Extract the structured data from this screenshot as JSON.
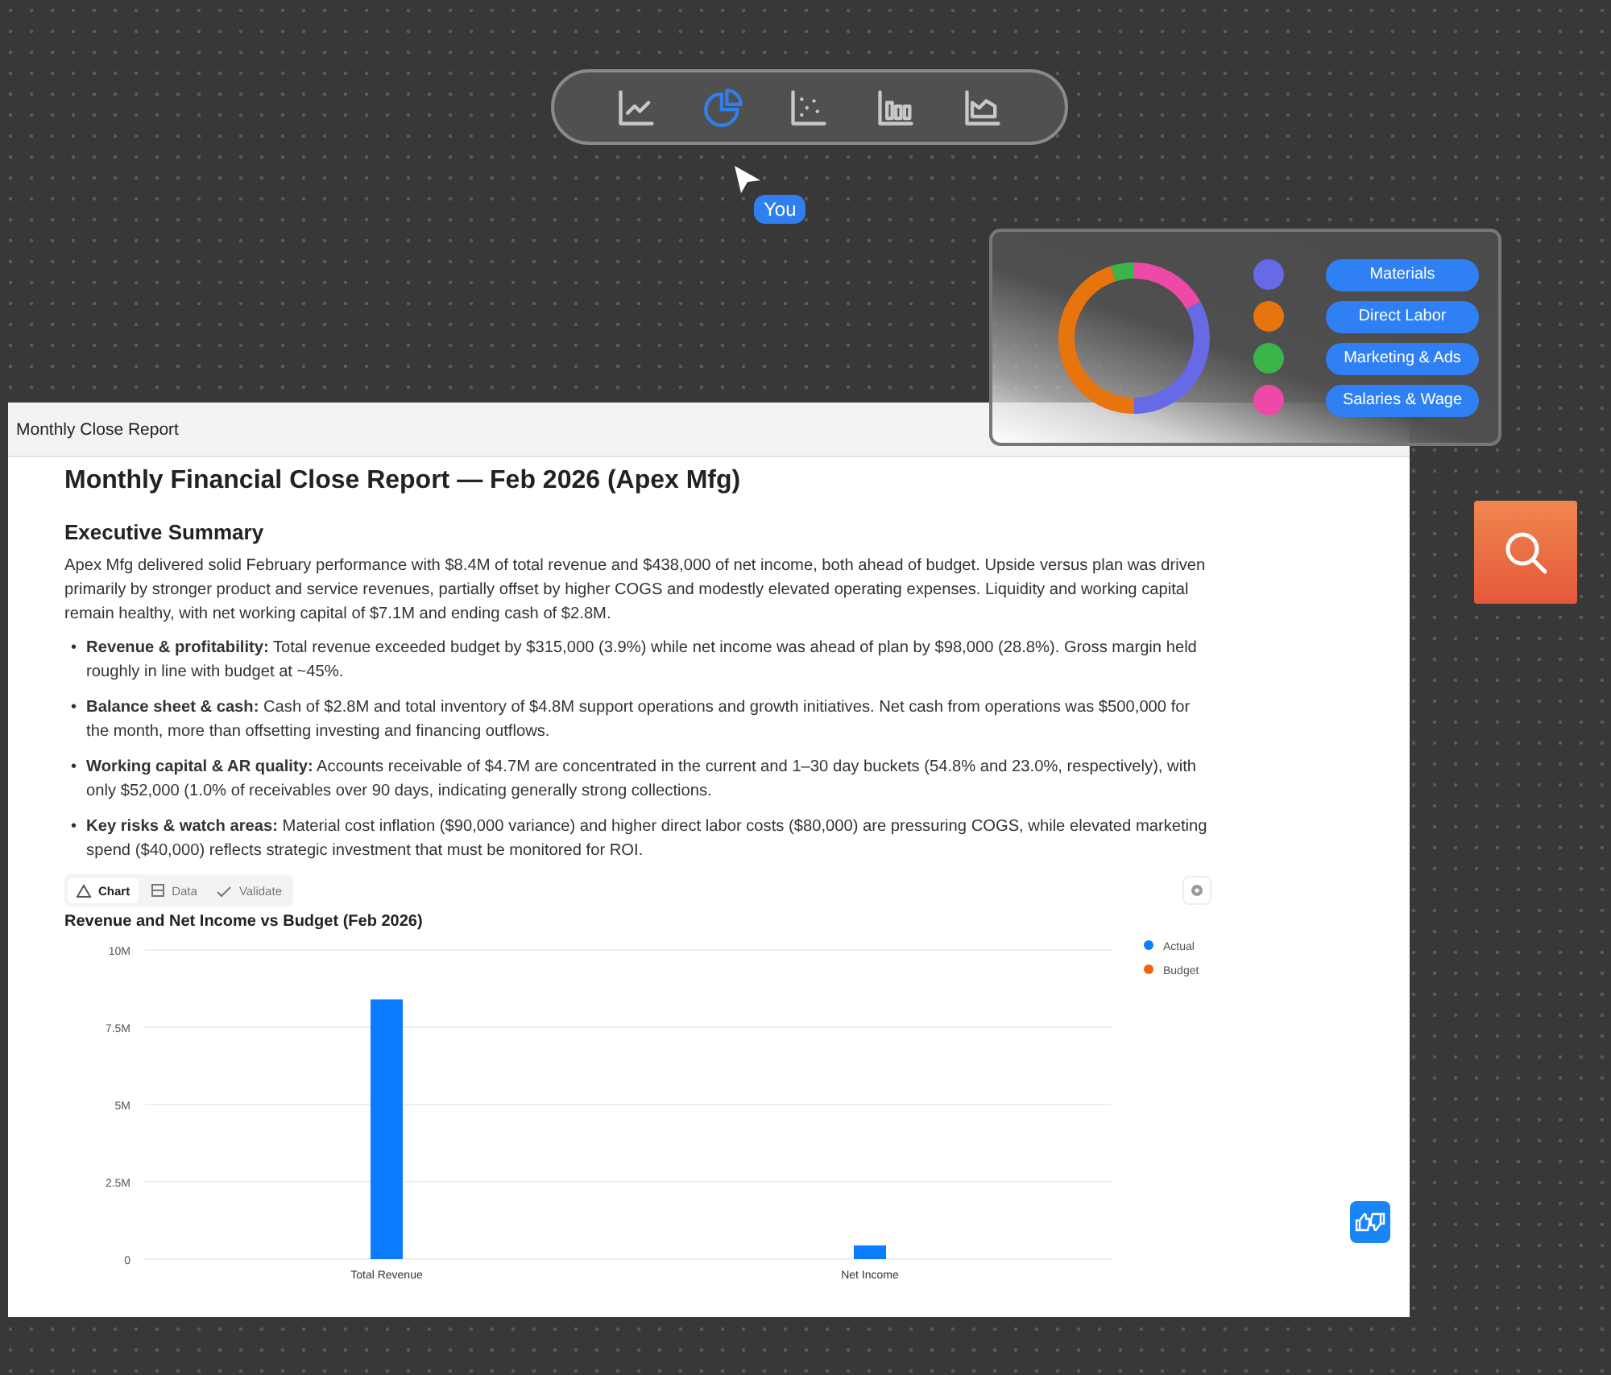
{
  "toolbar": {
    "items": [
      {
        "kind": "line",
        "selected": false
      },
      {
        "kind": "pie",
        "selected": true
      },
      {
        "kind": "scatter",
        "selected": false
      },
      {
        "kind": "bar",
        "selected": false
      },
      {
        "kind": "area",
        "selected": false
      }
    ]
  },
  "cursor": {
    "label": "You"
  },
  "legend_card": {
    "items": [
      {
        "label": "Materials",
        "color": "#676ae6"
      },
      {
        "label": "Direct Labor",
        "color": "#e8740e"
      },
      {
        "label": "Marketing & Ads",
        "color": "#3bb44a"
      },
      {
        "label": "Salaries & Wage",
        "color": "#ec4aa6"
      }
    ]
  },
  "report": {
    "window_title": "Monthly Close Report",
    "title": "Monthly Financial Close Report — Feb 2026 (Apex Mfg)",
    "summary_heading": "Executive Summary",
    "summary": "Apex Mfg delivered solid February performance with $8.4M of total revenue and $438,000 of net income, both ahead of budget. Upside versus plan was driven primarily by stronger product and service revenues, partially offset by higher COGS and modestly elevated operating expenses. Liquidity and working capital remain healthy, with net working capital of $7.1M and ending cash of $2.8M.",
    "bullets": [
      {
        "marker": "•",
        "text": "**Revenue & profitability:** Total revenue exceeded budget by $315,000 (3.9%) while net income was ahead of plan by $98,000 (28.8%). Gross margin held roughly in line with budget at ~45%."
      },
      {
        "marker": "•",
        "text": "**Balance sheet & cash:** Cash of $2.8M and total inventory of $4.8M support operations and growth initiatives. Net cash from operations was $500,000 for the month, more than offsetting investing and financing outflows."
      },
      {
        "marker": "•",
        "text": "**Working capital & AR quality:** Accounts receivable of $4.7M are concentrated in the current and 1–30 day buckets (54.8% and 23.0%, respectively), with only $52,000 (1.0% of receivables over 90 days, indicating generally strong collections."
      },
      {
        "marker": "•",
        "text": "**Key risks & watch areas:** Material cost inflation ($90,000 variance) and higher direct labor costs ($80,000) are pressuring COGS, while elevated marketing spend ($40,000) reflects strategic investment that must be monitored for ROI."
      }
    ],
    "chart_tabs": [
      {
        "kind": "chart",
        "label": "Chart",
        "selected": true
      },
      {
        "kind": "data",
        "label": "Data",
        "selected": false
      },
      {
        "kind": "validate",
        "label": "Validate",
        "selected": false
      }
    ],
    "chart_data": {
      "type": "bar",
      "title": "Revenue and Net Income vs Budget (Feb 2026)",
      "categories": [
        "Total Revenue",
        "Net Income"
      ],
      "series": [
        {
          "name": "Actual",
          "color": "#0a7cff",
          "values": [
            8400000,
            440000
          ]
        },
        {
          "name": "Budget",
          "color": "#f2650d",
          "values": [
            null,
            null
          ]
        }
      ],
      "ylim": [
        0,
        10000000
      ],
      "grid": true,
      "yticks": [
        {
          "value": 0,
          "label": "0"
        },
        {
          "value": 2500000,
          "label": "2.5M"
        },
        {
          "value": 5000000,
          "label": "5M"
        },
        {
          "value": 7500000,
          "label": "7.5M"
        },
        {
          "value": 10000000,
          "label": "10M"
        }
      ]
    }
  }
}
